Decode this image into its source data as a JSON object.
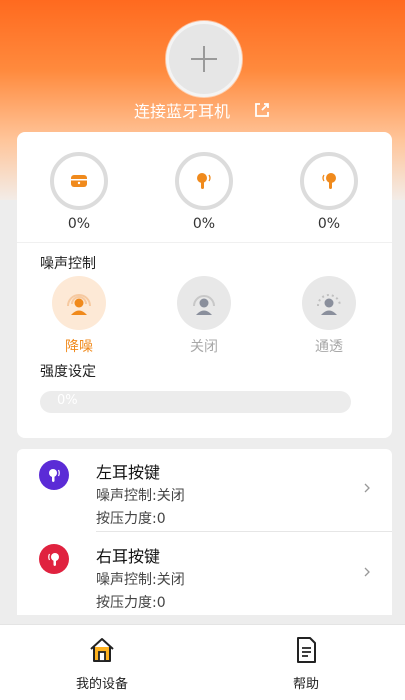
{
  "header": {
    "connect_label": "连接蓝牙耳机",
    "add_icon": "plus-icon",
    "share_icon": "external-link-icon"
  },
  "battery": [
    {
      "name": "case",
      "icon": "charging-case-icon",
      "level": "0%"
    },
    {
      "name": "left",
      "icon": "left-earbud-icon",
      "level": "0%"
    },
    {
      "name": "right",
      "icon": "right-earbud-icon",
      "level": "0%"
    }
  ],
  "noise": {
    "title": "噪声控制",
    "modes": [
      {
        "label": "降噪",
        "selected": true
      },
      {
        "label": "关闭",
        "selected": false
      },
      {
        "label": "通透",
        "selected": false
      }
    ]
  },
  "intensity": {
    "title": "强度设定",
    "value": "0%",
    "fraction": 0
  },
  "keys": [
    {
      "title": "左耳按键",
      "noise": "噪声控制:关闭",
      "pressure": "按压力度:0",
      "color": "#5b2bd6"
    },
    {
      "title": "右耳按键",
      "noise": "噪声控制:关闭",
      "pressure": "按压力度:0",
      "color": "#e0223f"
    }
  ],
  "tabs": [
    {
      "label": "我的设备",
      "icon": "home-icon",
      "active": true
    },
    {
      "label": "帮助",
      "icon": "document-icon",
      "active": false
    }
  ],
  "colors": {
    "accent": "#ff7a1f",
    "accent_light": "#fde9d6",
    "inactive": "#a8a8a8"
  }
}
